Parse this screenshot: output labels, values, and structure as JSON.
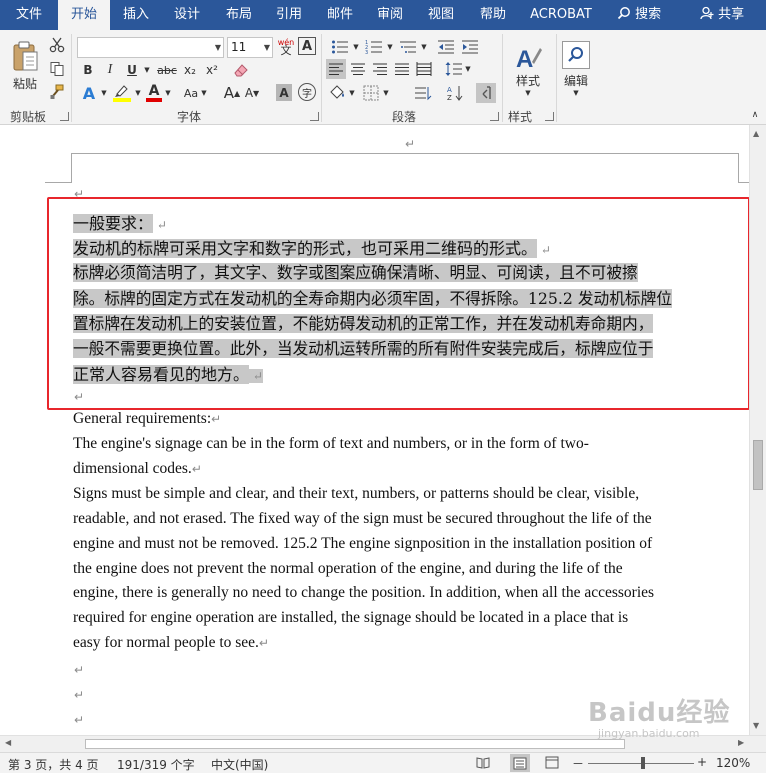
{
  "tabs": [
    "文件",
    "开始",
    "插入",
    "设计",
    "布局",
    "引用",
    "邮件",
    "审阅",
    "视图",
    "帮助",
    "ACROBAT"
  ],
  "search_label": "搜索",
  "share_label": "共享",
  "ribbon": {
    "paste_label": "粘贴",
    "font_size": "11",
    "groups": {
      "clipboard": "剪贴板",
      "font": "字体",
      "paragraph": "段落",
      "styles": "样式",
      "editing": "编辑"
    },
    "style_button_label": "样式",
    "edit_button_label": "编辑",
    "pinyin_label": "wén",
    "char_border_label": "A",
    "font_buttons": {
      "bold": "B",
      "italic": "I",
      "underline": "U",
      "strikethrough": "abc",
      "subscript": "x₂",
      "superscript": "x²",
      "grow_font": "A",
      "shrink_font": "A",
      "change_case": "Aa",
      "char_shading": "A",
      "enclose_char": "字"
    }
  },
  "document": {
    "cn_lines": [
      "一般要求：",
      "发动机的标牌可采用文字和数字的形式，也可采用二维码的形式。",
      "标牌必须简洁明了，其文字、数字或图案应确保清晰、明显、可阅读，且不可被擦",
      "除。标牌的固定方式在发动机的全寿命期内必须牢固，不得拆除。125.2 发动机标牌位",
      "置标牌在发动机上的安装位置，不能妨碍发动机的正常工作，并在发动机寿命期内，",
      "一般不需要更换位置。此外，当发动机运转所需的所有附件安装完成后，标牌应位于",
      "正常人容易看见的地方。"
    ],
    "en_lines": [
      "General requirements:",
      "The engine's signage can be in the form of text and numbers, or in the form of two-",
      "dimensional codes.",
      "Signs must be simple and clear, and their text, numbers, or patterns should be clear, visible,",
      "readable, and not erased. The fixed way of the sign must be secured throughout the life of the",
      "engine and must not be removed. 125.2 The engine signposition in the installation position of",
      "the engine does not prevent the normal operation of the engine, and during the life of the",
      "engine, there is generally no need to change the position. In addition, when all the accessories",
      "required for engine operation are installed, the signage should be located in a place that is",
      "easy for normal people to see."
    ]
  },
  "status": {
    "page": "第 3 页，共 4 页",
    "words": "191/319 个字",
    "language": "中文(中国)",
    "zoom": "120%",
    "zoom_minus": "－",
    "zoom_plus": "+"
  },
  "watermark": {
    "brand": "Baidu经验",
    "url": "jingyan.baidu.com"
  },
  "colors": {
    "tabbar": "#2b579a",
    "ribbon": "#f3f3f3",
    "selection": "#c8c8c8",
    "highlight_box": "#e8262c"
  }
}
